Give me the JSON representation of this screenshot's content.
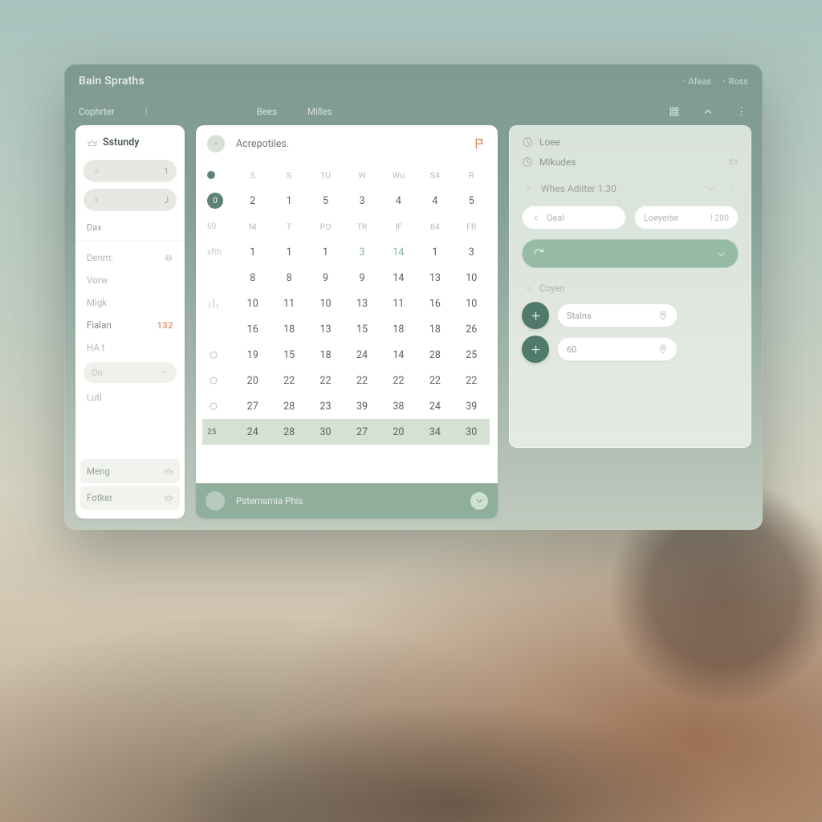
{
  "window": {
    "title": "Bain Spraths",
    "top_links": [
      "Afeas",
      "Ross"
    ]
  },
  "tabs": {
    "items": [
      "Cophrter",
      "!",
      "Bees",
      "Milles"
    ]
  },
  "sidebar": {
    "title": "Sstundy",
    "pills": [
      {
        "trail": "1"
      },
      {
        "trail": "J"
      }
    ],
    "section_label": "Dax",
    "items": [
      {
        "label": "Denm:",
        "icon": "paw"
      },
      {
        "label": "Vorw"
      },
      {
        "label": "Migk"
      },
      {
        "label": "Fialan",
        "trail": "132",
        "accent": true
      },
      {
        "label": "HA t"
      }
    ],
    "select": {
      "label": "On"
    },
    "post": {
      "label": "Lutl"
    },
    "footer": [
      {
        "label": "Meng",
        "icon": "crown"
      },
      {
        "label": "Fotker",
        "icon": "crown"
      }
    ]
  },
  "calendar": {
    "title": "Acrepotiles.",
    "dow1": [
      "S",
      "S",
      "TU",
      "W",
      "Wu",
      "S4",
      "R"
    ],
    "row_nums": [
      "2",
      "1",
      "5",
      "3",
      "4",
      "4",
      "5"
    ],
    "dow2": [
      "Nl",
      "T",
      "PO",
      "TR",
      "IF",
      "84",
      "FR"
    ],
    "leads": [
      "dot",
      "60",
      "sfth",
      "",
      "icon-bars",
      "",
      "icon-ring",
      "icon-ring",
      "hi"
    ],
    "grid": [
      [
        "1",
        "1",
        "1",
        "3",
        "14",
        "1",
        "3"
      ],
      [
        "8",
        "8",
        "9",
        "9",
        "14",
        "13",
        "10"
      ],
      [
        "10",
        "11",
        "10",
        "13",
        "11",
        "16",
        "10"
      ],
      [
        "16",
        "18",
        "13",
        "15",
        "18",
        "18",
        "26"
      ],
      [
        "19",
        "15",
        "18",
        "24",
        "14",
        "28",
        "25"
      ],
      [
        "20",
        "22",
        "22",
        "22",
        "22",
        "22",
        "22"
      ],
      [
        "27",
        "28",
        "23",
        "39",
        "38",
        "24",
        "39"
      ],
      [
        "24",
        "28",
        "30",
        "27",
        "20",
        "34",
        "30"
      ]
    ],
    "accent_cells": [
      [
        0,
        3
      ],
      [
        0,
        4
      ]
    ],
    "highlight_lead": "25",
    "footer_label": "Pstemsmia Phis"
  },
  "panel": {
    "row1": "Loee",
    "row2": "Mikudes",
    "sub": {
      "label": "Whes Adiiter 1.30"
    },
    "fields": [
      {
        "icon": "left",
        "value": "Oeal"
      },
      {
        "value": "Loeyeiše",
        "tail": "! 280"
      }
    ],
    "group_label": "Coyen",
    "chips": [
      {
        "value": "Stalns"
      },
      {
        "value": "60"
      }
    ]
  }
}
